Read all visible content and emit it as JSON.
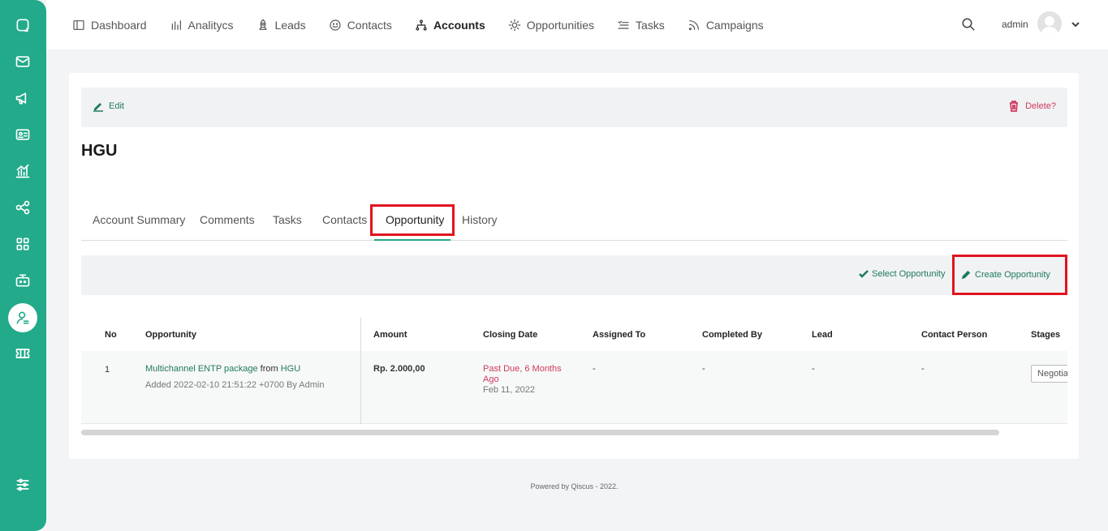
{
  "nav": {
    "items": [
      {
        "label": "Dashboard",
        "icon": "dashboard-icon"
      },
      {
        "label": "Analitycs",
        "icon": "bar-chart-icon"
      },
      {
        "label": "Leads",
        "icon": "rocket-icon"
      },
      {
        "label": "Contacts",
        "icon": "smile-icon"
      },
      {
        "label": "Accounts",
        "icon": "hierarchy-icon",
        "active": true
      },
      {
        "label": "Opportunities",
        "icon": "sun-icon"
      },
      {
        "label": "Tasks",
        "icon": "checklist-icon"
      },
      {
        "label": "Campaigns",
        "icon": "rss-icon"
      }
    ],
    "user_name": "admin"
  },
  "sidebar": {
    "icons": [
      "chat-icon",
      "mail-icon",
      "megaphone-icon",
      "id-card-icon",
      "analytics-icon",
      "share-icon",
      "apps-grid-icon",
      "bot-icon",
      "contact-person-icon",
      "ticket-icon",
      "settings-sliders-icon"
    ]
  },
  "actions": {
    "edit_label": "Edit",
    "delete_label": "Delete?"
  },
  "account": {
    "name": "HGU"
  },
  "tabs": [
    "Account Summary",
    "Comments",
    "Tasks",
    "Contacts",
    "Opportunity",
    "History"
  ],
  "active_tab": "Opportunity",
  "opportunity_actions": {
    "select_label": "Select Opportunity",
    "create_label": "Create Opportunity"
  },
  "table": {
    "headers": [
      "No",
      "Opportunity",
      "Amount",
      "Closing Date",
      "Assigned To",
      "Completed By",
      "Lead",
      "Contact Person",
      "Stages"
    ],
    "rows": [
      {
        "no": "1",
        "opportunity_name": "Multichannel ENTP package",
        "from_text": "from",
        "account": "HGU",
        "added": "Added 2022-02-10 21:51:22 +0700 By Admin",
        "amount": "Rp. 2.000,00",
        "past_due_line1": "Past Due, 6 Months",
        "past_due_line2": "Ago",
        "closing_date": "Feb 11, 2022",
        "assigned_to": "-",
        "completed_by": "-",
        "lead": "-",
        "contact_person": "-",
        "stage": "Negotiation"
      }
    ]
  },
  "footer": "Powered by Qiscus - 2022.",
  "colors": {
    "primary": "#22aa8a",
    "link": "#1f7a5d",
    "danger": "#d03a5f",
    "highlight": "#e0141e"
  }
}
